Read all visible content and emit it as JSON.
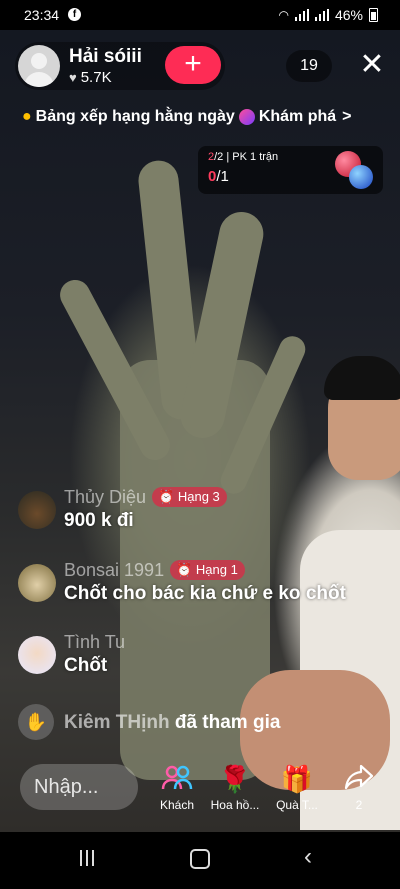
{
  "status_bar": {
    "time": "23:34",
    "battery": "46%"
  },
  "host": {
    "name": "Hải sóiii",
    "likes": "5.7K",
    "follow_label": "+"
  },
  "viewer_count": "19",
  "close_label": "✕",
  "ranking_banner": {
    "text": "Bảng xếp hạng hằng ngày",
    "explore": "Khám phá",
    "chevron": ">"
  },
  "pk_widget": {
    "round_current": "2",
    "round_total": "/2",
    "mode": "| PK 1 trận",
    "score_left": "0",
    "score_right": "/1"
  },
  "comments": [
    {
      "user": "Thủy Diệu",
      "badge": "Hạng 3",
      "message": "900 k đi"
    },
    {
      "user": "Bonsai 1991",
      "badge": "Hạng 1",
      "message": "Chốt cho bác kia chứ e ko chốt"
    },
    {
      "user": "Tình Tu",
      "badge": "",
      "message": "Chốt"
    }
  ],
  "join_event": {
    "user": "Kiêm THịnh",
    "text": "đã tham gia"
  },
  "bottom_bar": {
    "input_placeholder": "Nhập...",
    "actions": [
      {
        "icon": "guests-icon",
        "label": "Khách"
      },
      {
        "icon": "rose-icon",
        "label": "Hoa hồ..."
      },
      {
        "icon": "gift-icon",
        "label": "Quà T..."
      },
      {
        "icon": "share-icon",
        "label": "2"
      }
    ]
  },
  "colors": {
    "accent": "#fe2c55",
    "badge": "#dc2846"
  }
}
